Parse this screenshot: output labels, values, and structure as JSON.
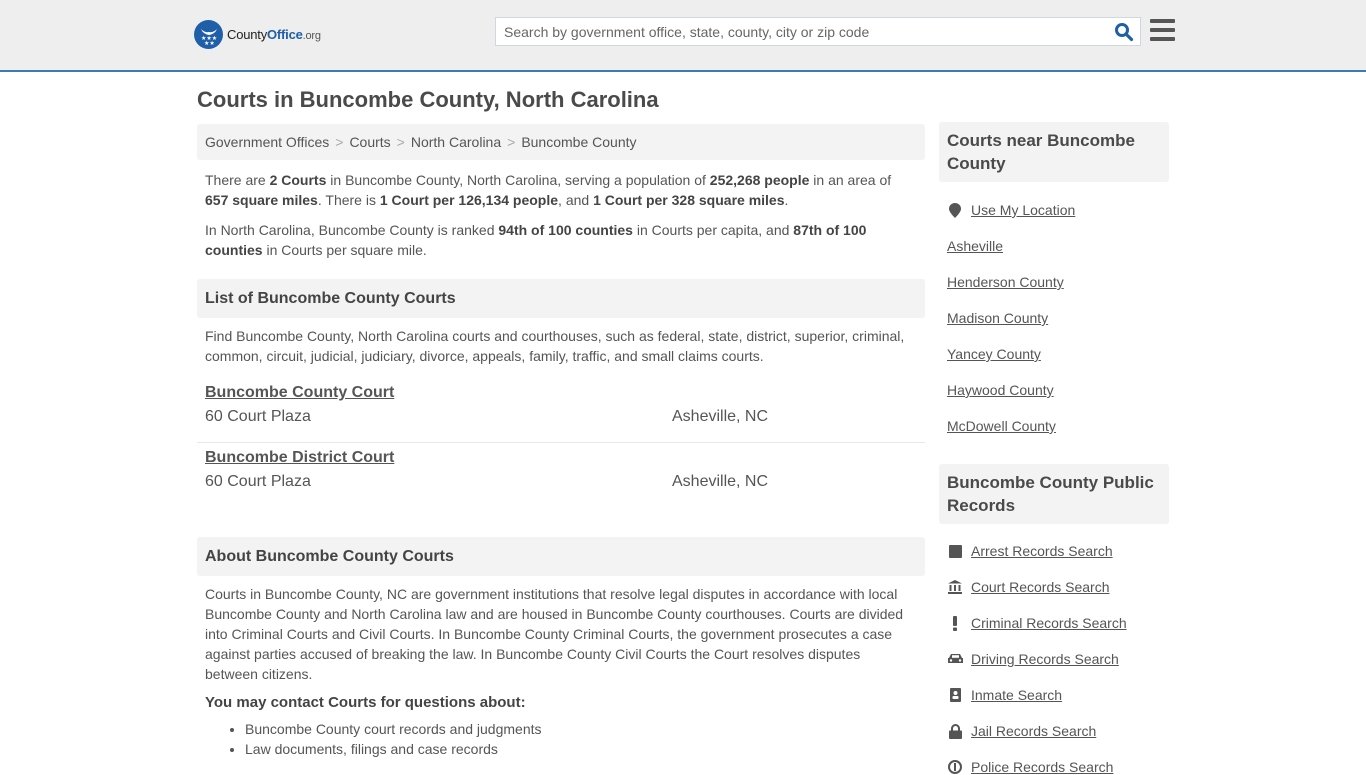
{
  "header": {
    "logo": {
      "name_part1": "County",
      "name_part2": "Office",
      "name_suffix": ".org"
    },
    "search": {
      "placeholder": "Search by government office, state, county, city or zip code",
      "value": ""
    },
    "search_icon": "search-icon",
    "menu_icon": "hamburger-menu-icon"
  },
  "page": {
    "title": "Courts in Buncombe County, North Carolina"
  },
  "breadcrumb": [
    {
      "label": "Government Offices"
    },
    {
      "label": "Courts"
    },
    {
      "label": "North Carolina"
    },
    {
      "label": "Buncombe County"
    }
  ],
  "intro": {
    "p1": {
      "t1": "There are ",
      "b1": "2 Courts",
      "t2": " in Buncombe County, North Carolina, serving a population of ",
      "b2": "252,268 people",
      "t3": " in an area of ",
      "b3": "657 square miles",
      "t4": ". There is ",
      "b4": "1 Court per 126,134 people",
      "t5": ", and ",
      "b5": "1 Court per 328 square miles",
      "t6": "."
    },
    "p2": {
      "t1": "In North Carolina, Buncombe County is ranked ",
      "b1": "94th of 100 counties",
      "t2": " in Courts per capita, and ",
      "b2": "87th of 100 counties",
      "t3": " in Courts per square mile."
    }
  },
  "list_section": {
    "heading": "List of Buncombe County Courts",
    "description": "Find Buncombe County, North Carolina courts and courthouses, such as federal, state, district, superior, criminal, common, circuit, judicial, judiciary, divorce, appeals, family, traffic, and small claims courts.",
    "courts": [
      {
        "name": "Buncombe County Court",
        "address": "60 Court Plaza",
        "city": "Asheville, NC"
      },
      {
        "name": "Buncombe District Court",
        "address": "60 Court Plaza",
        "city": "Asheville, NC"
      }
    ]
  },
  "about_section": {
    "heading": "About Buncombe County Courts",
    "body": "Courts in Buncombe County, NC are government institutions that resolve legal disputes in accordance with local Buncombe County and North Carolina law and are housed in Buncombe County courthouses. Courts are divided into Criminal Courts and Civil Courts. In Buncombe County Criminal Courts, the government prosecutes a case against parties accused of breaking the law. In Buncombe County Civil Courts the Court resolves disputes between citizens.",
    "contact_heading": "You may contact Courts for questions about:",
    "contact_items": [
      "Buncombe County court records and judgments",
      "Law documents, filings and case records"
    ]
  },
  "sidebar": {
    "nearby": {
      "heading": "Courts near Buncombe County",
      "use_location": {
        "label": "Use My Location",
        "icon": "map-marker-icon"
      },
      "links": [
        "Asheville",
        "Henderson County",
        "Madison County",
        "Yancey County",
        "Haywood County",
        "McDowell County"
      ]
    },
    "records": {
      "heading": "Buncombe County Public Records",
      "links": [
        {
          "label": "Arrest Records Search",
          "icon": "square-icon"
        },
        {
          "label": "Court Records Search",
          "icon": "courthouse-icon"
        },
        {
          "label": "Criminal Records Search",
          "icon": "exclamation-icon"
        },
        {
          "label": "Driving Records Search",
          "icon": "car-icon"
        },
        {
          "label": "Inmate Search",
          "icon": "id-badge-icon"
        },
        {
          "label": "Jail Records Search",
          "icon": "lock-icon"
        },
        {
          "label": "Police Records Search",
          "icon": "police-icon"
        }
      ]
    }
  }
}
